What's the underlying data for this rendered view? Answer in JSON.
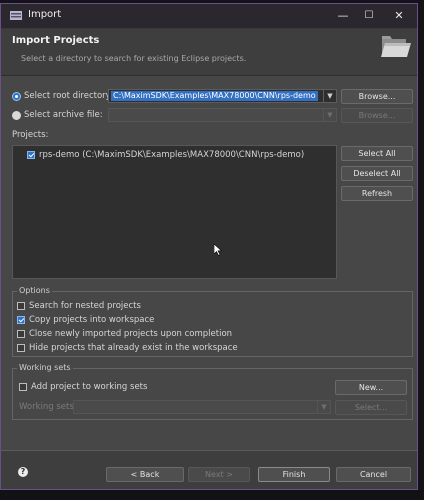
{
  "window": {
    "title": "Import",
    "minimize_glyph": "—",
    "maximize_glyph": "☐",
    "close_glyph": "✕",
    "accent": "#6a4f8a"
  },
  "banner": {
    "heading": "Import Projects",
    "subtitle": "Select a directory to search for existing Eclipse projects."
  },
  "source": {
    "root_label": "Select root directory:",
    "root_value": "C:\\MaximSDK\\Examples\\MAX78000\\CNN\\rps-demo",
    "archive_label": "Select archive file:",
    "archive_value": "",
    "browse_label": "Browse...",
    "archive_browse_label": "Browse..."
  },
  "projects": {
    "label": "Projects:",
    "items": [
      {
        "text": "rps-demo (C:\\MaximSDK\\Examples\\MAX78000\\CNN\\rps-demo)",
        "checked": true
      }
    ],
    "select_all_label": "Select All",
    "deselect_all_label": "Deselect All",
    "refresh_label": "Refresh"
  },
  "options": {
    "legend": "Options",
    "items": [
      {
        "label": "Search for nested projects",
        "checked": false
      },
      {
        "label": "Copy projects into workspace",
        "checked": true
      },
      {
        "label": "Close newly imported projects upon completion",
        "checked": false
      },
      {
        "label": "Hide projects that already exist in the workspace",
        "checked": false
      }
    ]
  },
  "working_sets": {
    "legend": "Working sets",
    "add_label": "Add project to working sets",
    "add_checked": false,
    "new_label": "New...",
    "sets_label": "Working sets:",
    "sets_value": "",
    "select_label": "Select..."
  },
  "footer": {
    "help_glyph": "?",
    "back_label": "< Back",
    "next_label": "Next >",
    "finish_label": "Finish",
    "cancel_label": "Cancel"
  },
  "colors": {
    "window_bg": "#474748",
    "selection": "#3270c4",
    "checkbox_on": "#2d73c9"
  }
}
